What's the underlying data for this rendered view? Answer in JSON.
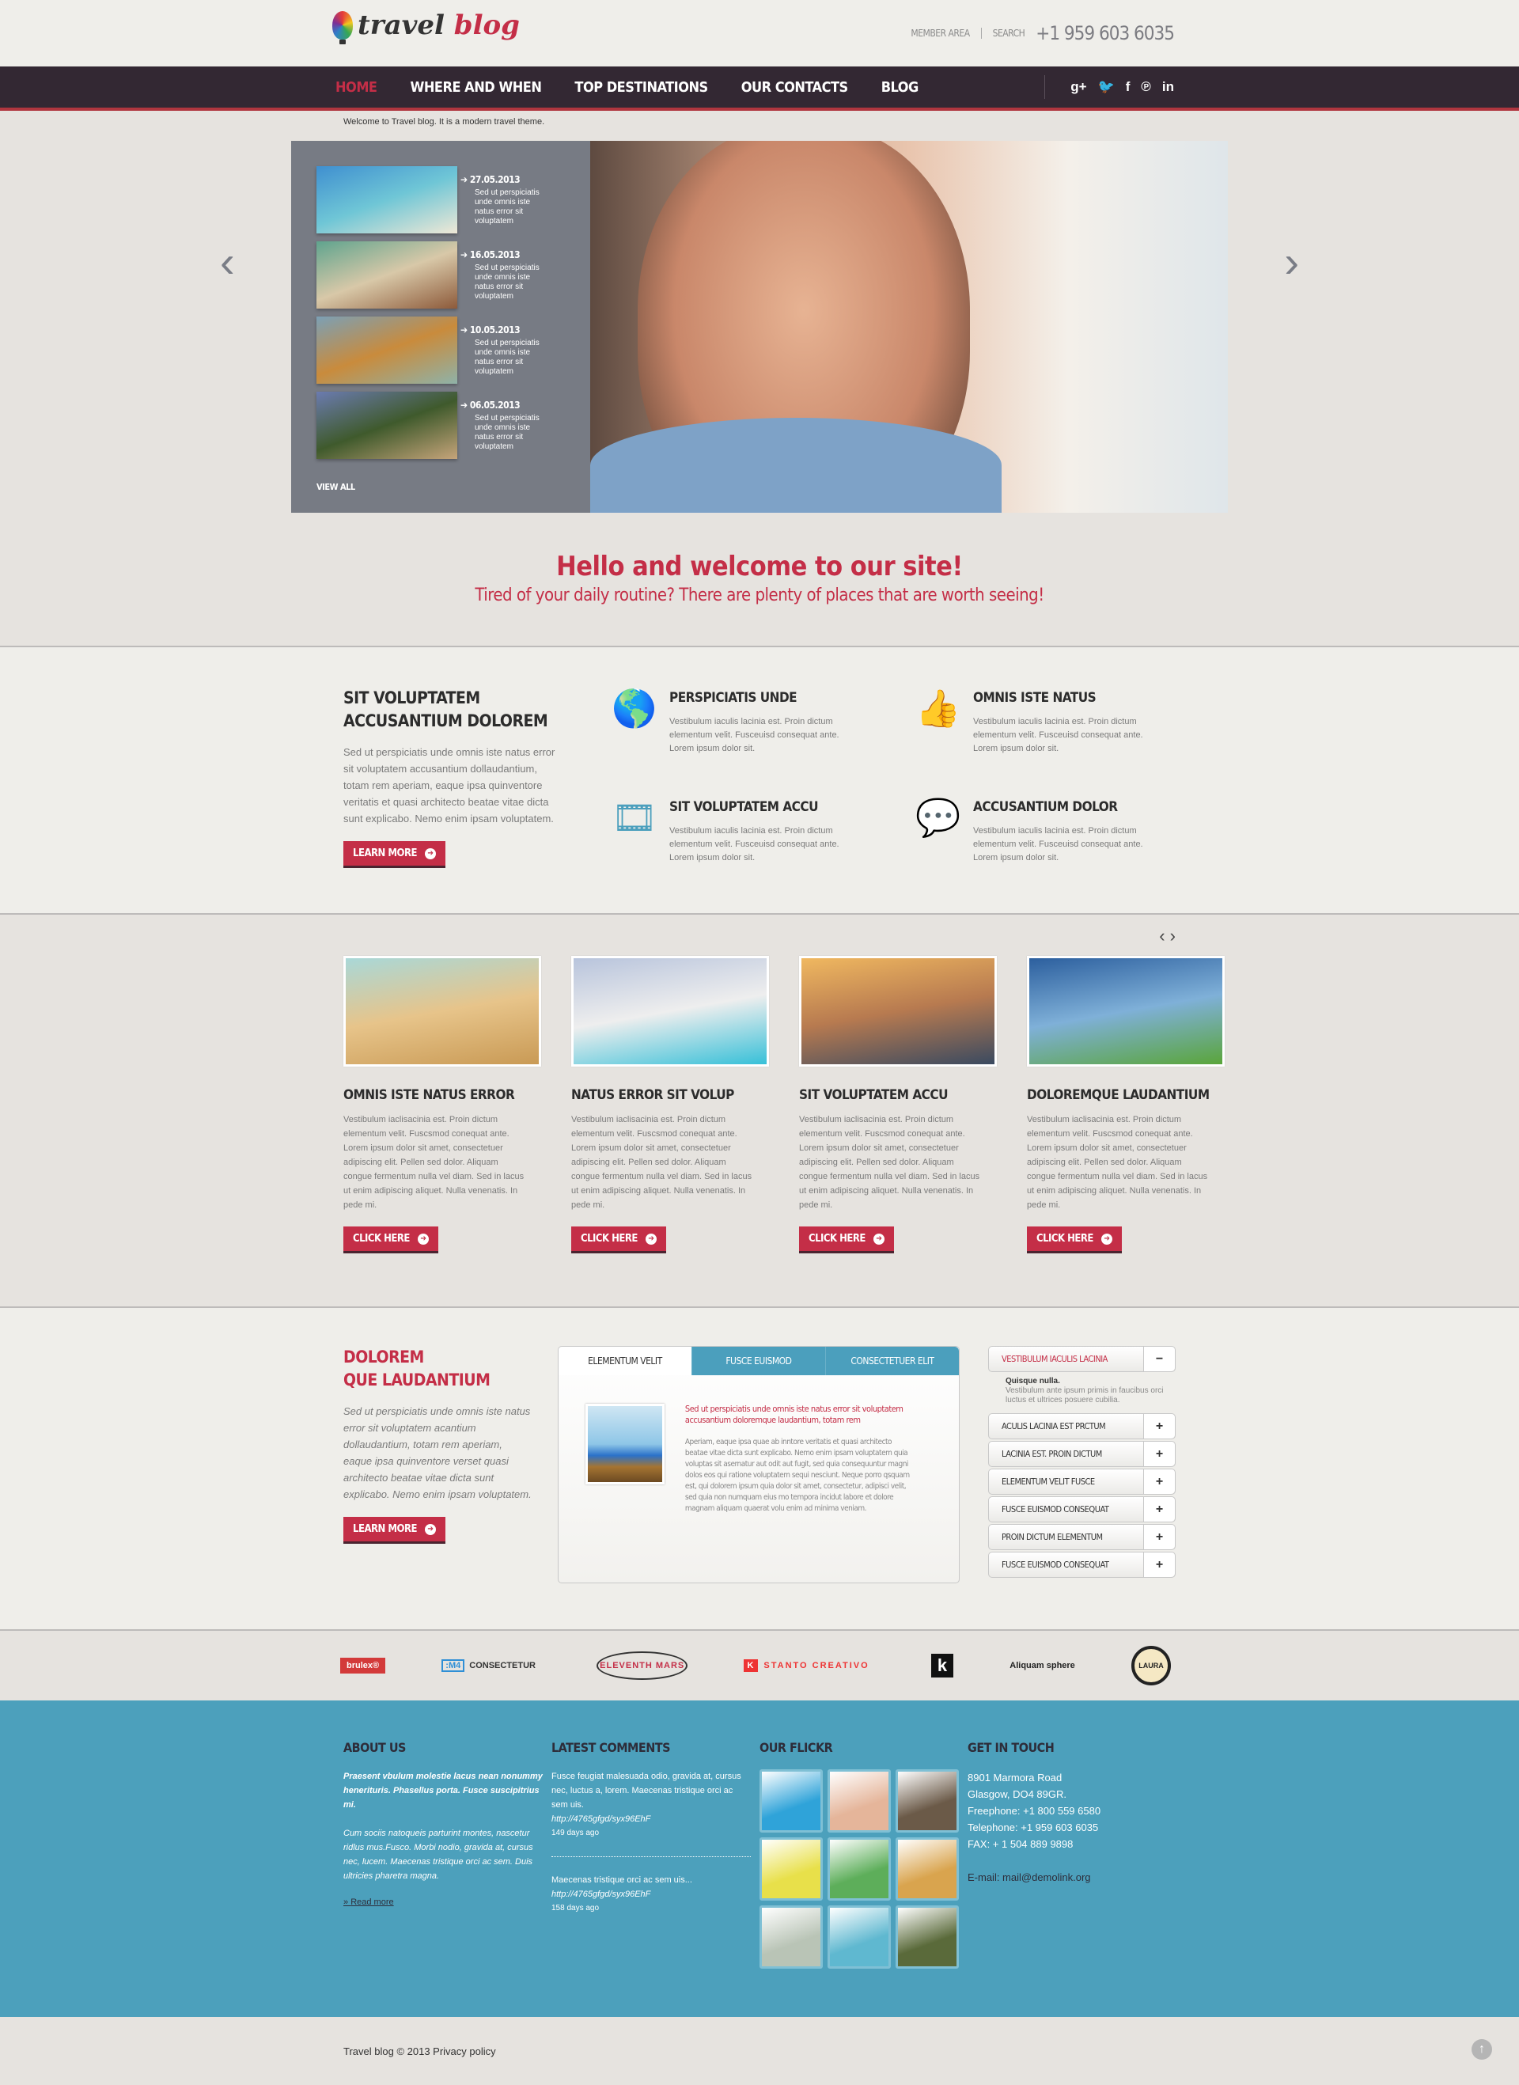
{
  "header": {
    "logo_word1": "travel",
    "logo_word2": "blog",
    "member_area": "MEMBER AREA",
    "search": "SEARCH",
    "phone": "+1 959 603 6035"
  },
  "nav": {
    "items": [
      "HOME",
      "WHERE AND WHEN",
      "TOP DESTINATIONS",
      "OUR CONTACTS",
      "BLOG"
    ],
    "active": "HOME",
    "social": [
      {
        "icon": "google-plus-icon",
        "glyph": "g+"
      },
      {
        "icon": "twitter-icon",
        "glyph": "🐦"
      },
      {
        "icon": "facebook-icon",
        "glyph": "f"
      },
      {
        "icon": "pinterest-icon",
        "glyph": "℗"
      },
      {
        "icon": "linkedin-icon",
        "glyph": "in"
      }
    ]
  },
  "welcome_text": "Welcome to Travel blog. It is a modern travel theme.",
  "slider": {
    "items": [
      {
        "date": "27.05.2013",
        "text": "Sed ut perspiciatis unde omnis iste natus error sit voluptatem",
        "colors": [
          "#3f8fd0",
          "#6fc6d6",
          "#efe8d6"
        ]
      },
      {
        "date": "16.05.2013",
        "text": "Sed ut perspiciatis unde omnis iste natus error sit voluptatem",
        "colors": [
          "#5fa48e",
          "#d8c8a8",
          "#8d5a3a"
        ]
      },
      {
        "date": "10.05.2013",
        "text": "Sed ut perspiciatis unde omnis iste natus error sit voluptatem",
        "colors": [
          "#7ba0b6",
          "#c98b3c",
          "#8fb2a8"
        ]
      },
      {
        "date": "06.05.2013",
        "text": "Sed ut perspiciatis unde omnis iste natus error sit voluptatem",
        "colors": [
          "#6b7bb0",
          "#3f5a2c",
          "#c6a47a"
        ]
      }
    ],
    "view_all": "VIEW ALL"
  },
  "intro": {
    "title": "Hello and welcome to our site!",
    "subtitle": "Tired of your daily routine? There are plenty of places that are worth seeing!"
  },
  "features": {
    "lead_title_1": "SIT VOLUPTATEM",
    "lead_title_2": "ACCUSANTIUM DOLOREM",
    "lead_text": "Sed ut perspiciatis unde omnis iste natus error sit voluptatem accusantium dollaudantium, totam rem aperiam, eaque ipsa quinventore veritatis et quasi architecto beatae vitae dicta sunt explicabo. Nemo enim ipsam voluptatem.",
    "button": "LEARN MORE",
    "items": [
      {
        "icon": "globe-icon",
        "glyph": "🌎",
        "title": "PERSPICIATIS UNDE",
        "text": "Vestibulum iaculis lacinia est. Proin dictum elementum velit. Fusceuisd consequat ante. Lorem ipsum dolor sit."
      },
      {
        "icon": "thumbs-up-icon",
        "glyph": "👍",
        "title": "OMNIS ISTE NATUS",
        "text": "Vestibulum iaculis lacinia est. Proin dictum elementum velit. Fusceuisd consequat ante. Lorem ipsum dolor sit."
      },
      {
        "icon": "film-icon",
        "glyph": "🎞",
        "title": "SIT VOLUPTATEM ACCU",
        "text": "Vestibulum iaculis lacinia est. Proin dictum elementum velit. Fusceuisd consequat ante. Lorem ipsum dolor sit."
      },
      {
        "icon": "chat-bubbles-icon",
        "glyph": "💬",
        "title": "ACCUSANTIUM DOLOR",
        "text": "Vestibulum iaculis lacinia est. Proin dictum elementum velit. Fusceuisd consequat ante. Lorem ipsum dolor sit."
      }
    ]
  },
  "cards": {
    "items": [
      {
        "title": "OMNIS ISTE NATUS ERROR",
        "text": "Vestibulum iaclisacinia est. Proin dictum elementum velit. Fuscsmod conequat ante. Lorem ipsum dolor sit amet, consectetuer adipiscing elit. Pellen sed dolor. Aliquam congue fermentum  nulla vel diam. Sed in lacus ut enim adipiscing aliquet. Nulla venenatis. In pede mi.",
        "button": "CLICK HERE",
        "colors": [
          "#a9d8d8",
          "#e7c48a",
          "#c99a55"
        ]
      },
      {
        "title": "NATUS ERROR SIT VOLUP",
        "text": "Vestibulum iaclisacinia est. Proin dictum elementum velit. Fuscsmod conequat ante. Lorem ipsum dolor sit amet, consectetuer adipiscing elit. Pellen sed dolor. Aliquam congue fermentum  nulla vel diam. Sed in lacus ut enim adipiscing aliquet. Nulla venenatis. In pede mi.",
        "button": "CLICK HERE",
        "colors": [
          "#b8c4dc",
          "#eeeeee",
          "#37c0d8"
        ]
      },
      {
        "title": "SIT VOLUPTATEM ACCU",
        "text": "Vestibulum iaclisacinia est. Proin dictum elementum velit. Fuscsmod conequat ante. Lorem ipsum dolor sit amet, consectetuer adipiscing elit. Pellen sed dolor. Aliquam congue fermentum  nulla vel diam. Sed in lacus ut enim adipiscing aliquet. Nulla venenatis. In pede mi.",
        "button": "CLICK HERE",
        "colors": [
          "#f0b860",
          "#b77a50",
          "#3a4a60"
        ]
      },
      {
        "title": "DOLOREMQUE LAUDANTIUM",
        "text": "Vestibulum iaclisacinia est. Proin dictum elementum velit. Fuscsmod conequat ante. Lorem ipsum dolor sit amet, consectetuer adipiscing elit. Pellen sed dolor. Aliquam congue fermentum  nulla vel diam. Sed in lacus ut enim adipiscing aliquet. Nulla venenatis. In pede mi.",
        "button": "CLICK HERE",
        "colors": [
          "#2c5f9e",
          "#7fb0d8",
          "#5aa53a"
        ]
      }
    ]
  },
  "tabsec": {
    "title_1": "DOLOREM",
    "title_2": "QUE LAUDANTIUM",
    "text": "Sed ut perspiciatis unde omnis iste natus error sit voluptatem acantium dollaudantium, totam rem aperiam, eaque ipsa quinventore verset quasi architecto beatae vitae dicta sunt explicabo. Nemo enim ipsam voluptatem.",
    "button": "LEARN MORE",
    "tabs": [
      "ELEMENTUM VELIT",
      "FUSCE EUISMOD",
      "CONSECTETUER ELIT"
    ],
    "active_tab": "ELEMENTUM VELIT",
    "tab_lead": "Sed ut perspiciatis unde omnis iste natus error sit voluptatem accusantium doloremque laudantium, totam rem",
    "tab_body": "Aperiam, eaque ipsa quae ab inntore veritatis et quasi architecto beatae vitae dicta sunt explicabo. Nemo enim ipsam voluptatem quia voluptas sit asernatur aut odit aut fugit, sed quia consequuntur magni dolos eos qui ratione voluptatem sequi nesciunt. Neque porro qsquam est, qui dolorem ipsum quia dolor sit amet, consectetur, adipisci velit, sed quia non numquam eius mo tempora incidut labore et dolore magnam aliquam quaerat volu enim ad minima veniam.",
    "accordion": {
      "open": {
        "label": "VESTIBULUM IACULIS LACINIA",
        "toggle": "−",
        "body_title": "Quisque nulla.",
        "body_text": "Vestibulum ante ipsum primis in faucibus orci luctus et ultrices posuere cubilia."
      },
      "closed": [
        {
          "label": "ACULIS LACINIA EST PRCTUM",
          "toggle": "+"
        },
        {
          "label": "LACINIA EST. PROIN DICTUM",
          "toggle": "+"
        },
        {
          "label": "ELEMENTUM VELIT FUSCE",
          "toggle": "+"
        },
        {
          "label": "FUSCE EUISMOD CONSEQUAT",
          "toggle": "+"
        },
        {
          "label": "PROIN DICTUM ELEMENTUM",
          "toggle": "+"
        },
        {
          "label": "FUSCE EUISMOD CONSEQUAT",
          "toggle": "+"
        }
      ]
    }
  },
  "brands": {
    "b1": "brulex®",
    "b2_mark": ":M4",
    "b2_text": "CONSECTETUR",
    "b3": "ELEVENTH MARS",
    "b4_mark": "K",
    "b4_text": "STANTO CREATIVO",
    "b5": "k",
    "b6": "Aliquam sphere",
    "b7": "LAURA"
  },
  "footer": {
    "about": {
      "title": "ABOUT US",
      "strong": "Praesent vbulum molestie lacus nean nonummy henerituris. Phasellus porta. Fusce suscipitrius mi.",
      "text": "Cum sociis natoqueis parturint montes, nascetur ridlus mus.Fusco. Morbi nodio, gravida at, cursus nec, lucem. Maecenas tristique orci ac sem. Duis ultricies pharetra magna.",
      "read_more": "Read more"
    },
    "comments": {
      "title": "LATEST COMMENTS",
      "items": [
        {
          "text": "Fusce feugiat malesuada odio, gravida at, cursus nec, luctus a, lorem. Maecenas tristique orci ac sem uis.",
          "url": "http://4765gfgd/syx96EhF",
          "ago": "149 days ago"
        },
        {
          "text": "Maecenas tristique orci ac sem uis...",
          "url": "http://4765gfgd/syx96EhF",
          "ago": "158 days ago"
        }
      ]
    },
    "flickr": {
      "title": "OUR FLICKR",
      "photos": [
        "#2fa3d9",
        "#e5b59a",
        "#6b5a48",
        "#e8e04a",
        "#5dae5a",
        "#d9a44e",
        "#b9c4b6",
        "#5fb8d0",
        "#5a6a3a"
      ]
    },
    "touch": {
      "title": "GET IN TOUCH",
      "address_1": "8901 Marmora Road",
      "address_2": "Glasgow, DO4 89GR.",
      "freephone": "Freephone:  +1 800 559 6580",
      "telephone": "Telephone:   +1 959 603 6035",
      "fax": "FAX:            + 1 504 889 9898",
      "email": "E-mail: mail@demolink.org"
    }
  },
  "bottom": {
    "copyright": "Travel blog © 2013 Privacy policy"
  }
}
